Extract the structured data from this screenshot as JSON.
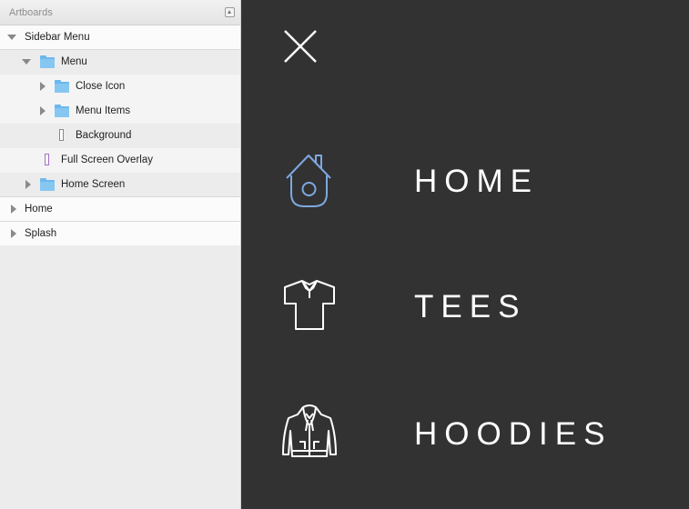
{
  "panel": {
    "title": "Artboards",
    "tree": [
      {
        "label": "Sidebar Menu",
        "kind": "artboard",
        "expanded": true
      },
      {
        "label": "Menu",
        "kind": "folder",
        "expanded": true
      },
      {
        "label": "Close Icon",
        "kind": "folder",
        "expanded": false
      },
      {
        "label": "Menu Items",
        "kind": "folder",
        "expanded": false
      },
      {
        "label": "Background",
        "kind": "rectangle"
      },
      {
        "label": "Full Screen Overlay",
        "kind": "rectangle"
      },
      {
        "label": "Home Screen",
        "kind": "folder",
        "expanded": false
      },
      {
        "label": "Home",
        "kind": "artboard",
        "expanded": false
      },
      {
        "label": "Splash",
        "kind": "artboard",
        "expanded": false
      }
    ]
  },
  "canvas": {
    "close_icon": "close-icon",
    "menu": [
      {
        "label": "HOME",
        "icon": "birdhouse-icon",
        "icon_color": "#7ea8e0"
      },
      {
        "label": "TEES",
        "icon": "tshirt-icon",
        "icon_color": "#ffffff"
      },
      {
        "label": "HOODIES",
        "icon": "hoodie-icon",
        "icon_color": "#ffffff"
      }
    ],
    "background_color": "#323232"
  }
}
